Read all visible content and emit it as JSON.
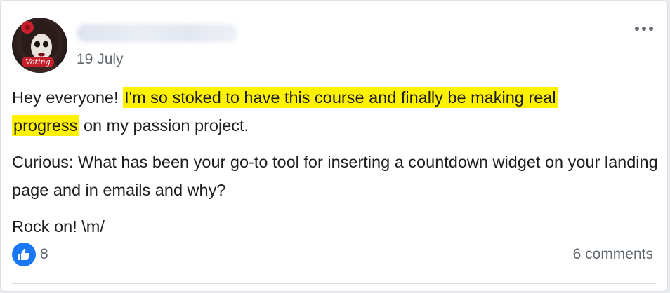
{
  "post": {
    "date": "19 July",
    "paragraph1": {
      "before": "Hey everyone! ",
      "highlight_line1": "I'm so stoked to have this course and finally be making real",
      "highlight_line2": "progress",
      "after": " on my passion project."
    },
    "paragraph2": "Curious: What has been your go-to tool for inserting a countdown widget on your landing page and in emails and why?",
    "paragraph3": "Rock on! \\m/",
    "avatar_badge": "Voting",
    "like_count": "8",
    "comments_label": "6 comments"
  },
  "icons": {
    "more": "more-options-icon",
    "like": "thumbs-up-icon"
  },
  "colors": {
    "highlight": "#fff200",
    "like_blue": "#1877f2",
    "text": "#1c1e21",
    "muted": "#606770"
  }
}
